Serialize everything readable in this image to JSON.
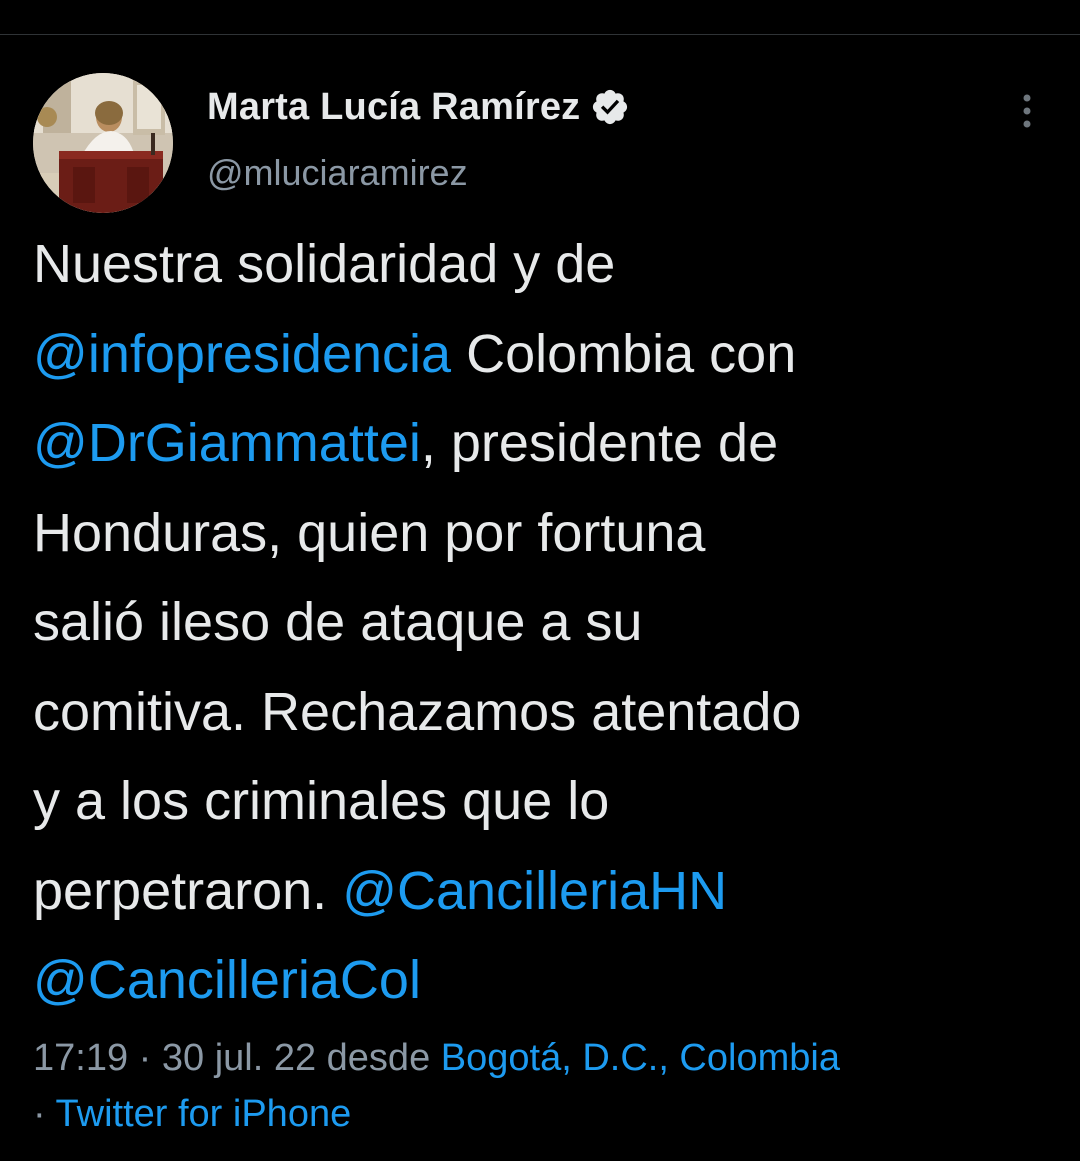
{
  "author": {
    "display_name": "Marta Lucía Ramírez",
    "handle": "@mluciaramirez",
    "verified_icon": "verified-badge-icon",
    "avatar_icon": "profile-photo"
  },
  "more_icon": "more-options-icon",
  "tweet": {
    "lines": [
      [
        {
          "text": "Nuestra solidaridad y de",
          "type": "text"
        }
      ],
      [
        {
          "text": "@infopresidencia",
          "type": "mention"
        },
        {
          "text": " Colombia con",
          "type": "text"
        }
      ],
      [
        {
          "text": "@DrGiammattei",
          "type": "mention"
        },
        {
          "text": ", presidente de",
          "type": "text"
        }
      ],
      [
        {
          "text": "Honduras, quien por fortuna",
          "type": "text"
        }
      ],
      [
        {
          "text": "salió ileso de ataque a su",
          "type": "text"
        }
      ],
      [
        {
          "text": "comitiva. Rechazamos atentado",
          "type": "text"
        }
      ],
      [
        {
          "text": "y a los criminales que lo",
          "type": "text"
        }
      ],
      [
        {
          "text": "perpetraron. ",
          "type": "text"
        },
        {
          "text": "@CancilleriaHN",
          "type": "mention"
        }
      ],
      [
        {
          "text": "@CancilleriaCol",
          "type": "mention"
        }
      ]
    ]
  },
  "meta": {
    "time": "17:19",
    "separator": " · ",
    "date": "30 jul. 22",
    "from_label": " desde ",
    "location": "Bogotá, D.C., Colombia",
    "separator2": "· ",
    "source": "Twitter for iPhone"
  },
  "colors": {
    "background": "#000000",
    "text": "#e7e9ea",
    "secondary": "#8b98a5",
    "link": "#1d9bf0"
  }
}
